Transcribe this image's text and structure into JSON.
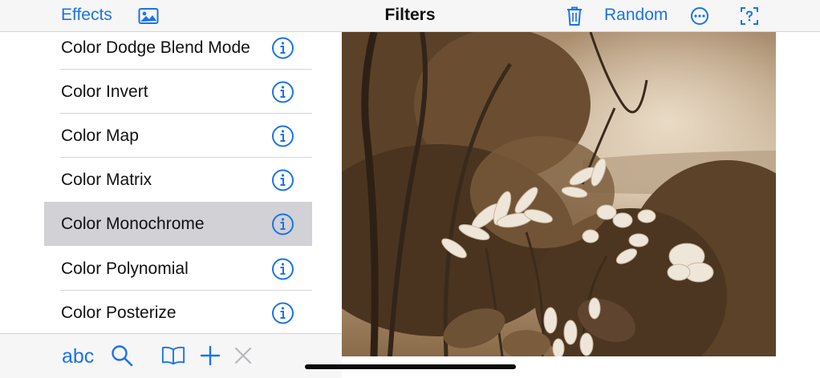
{
  "nav": {
    "left_label": "Effects",
    "title": "Filters",
    "random_label": "Random",
    "accent": "#1a73e8",
    "icons": [
      "photo-icon",
      "trash-icon",
      "ellipsis-circle-icon",
      "help-icon"
    ]
  },
  "filters": [
    {
      "name": "Color Dodge Blend Mode",
      "selected": false
    },
    {
      "name": "Color Invert",
      "selected": false
    },
    {
      "name": "Color Map",
      "selected": false
    },
    {
      "name": "Color Matrix",
      "selected": false
    },
    {
      "name": "Color Monochrome",
      "selected": true
    },
    {
      "name": "Color Polynomial",
      "selected": false
    },
    {
      "name": "Color Posterize",
      "selected": false
    }
  ],
  "toolbar": {
    "abc_label": "abc",
    "icons": [
      "search-icon",
      "book-icon",
      "plus-icon",
      "close-icon"
    ]
  },
  "preview": {
    "filter": "sepia monochrome",
    "tint": "#8a6a48"
  }
}
